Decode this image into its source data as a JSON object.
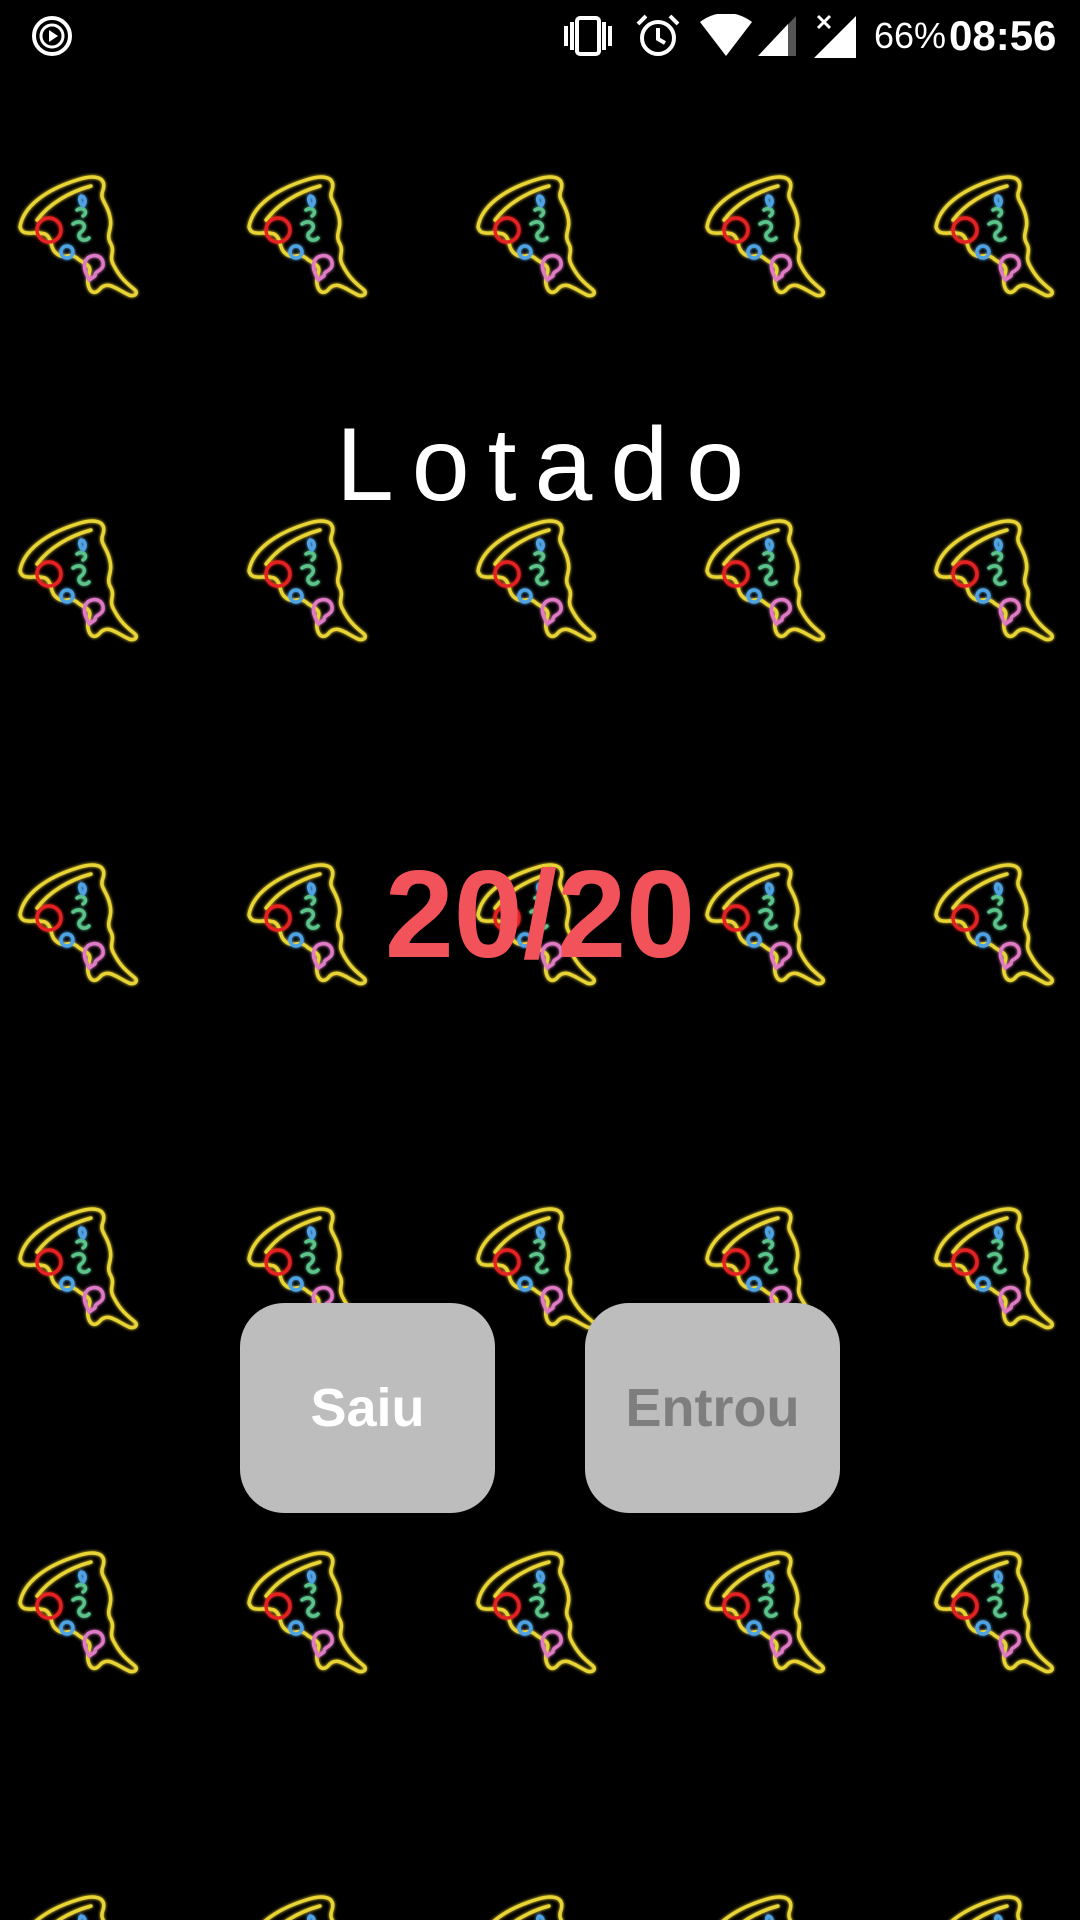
{
  "status_bar": {
    "battery": "66%",
    "time": "08:56",
    "icons": [
      "play-circle-icon",
      "vibrate-icon",
      "alarm-icon",
      "wifi-icon",
      "cell-signal-icon",
      "cell-signal-no-data-icon"
    ]
  },
  "main": {
    "title": "Lotado",
    "counter": "20/20"
  },
  "buttons": {
    "left_label": "Saiu",
    "right_label": "Entrou"
  },
  "colors": {
    "background": "#000000",
    "counter": "#F2535A",
    "button_bg": "#BDBDBD",
    "button_enabled_text": "#FFFFFF",
    "button_disabled_text": "#7E7E7E"
  }
}
